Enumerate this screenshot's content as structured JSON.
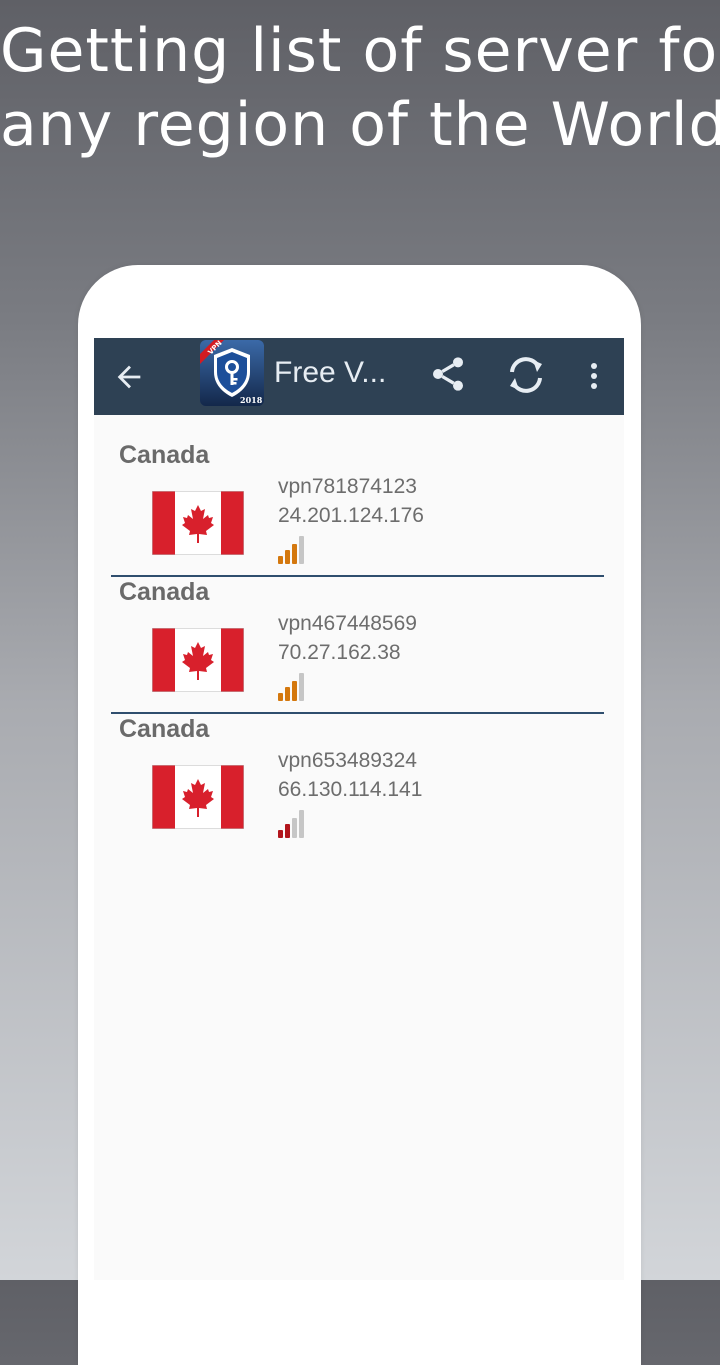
{
  "headline": {
    "line1": "Getting list of server for",
    "line2": "any region of the World"
  },
  "toolbar": {
    "title": "Free V...",
    "logo_badge": "VPN",
    "logo_year": "2018",
    "colors": {
      "background": "#2e4154",
      "icon": "#e7edf3"
    }
  },
  "servers": [
    {
      "country": "Canada",
      "host": "vpn781874123",
      "ip": "24.201.124.176",
      "signal_color": "#d4780e",
      "signal_active_bars": 3
    },
    {
      "country": "Canada",
      "host": "vpn467448569",
      "ip": "70.27.162.38",
      "signal_color": "#d4780e",
      "signal_active_bars": 3
    },
    {
      "country": "Canada",
      "host": "vpn653489324",
      "ip": "66.130.114.141",
      "signal_color": "#b2151c",
      "signal_active_bars": 2
    }
  ]
}
